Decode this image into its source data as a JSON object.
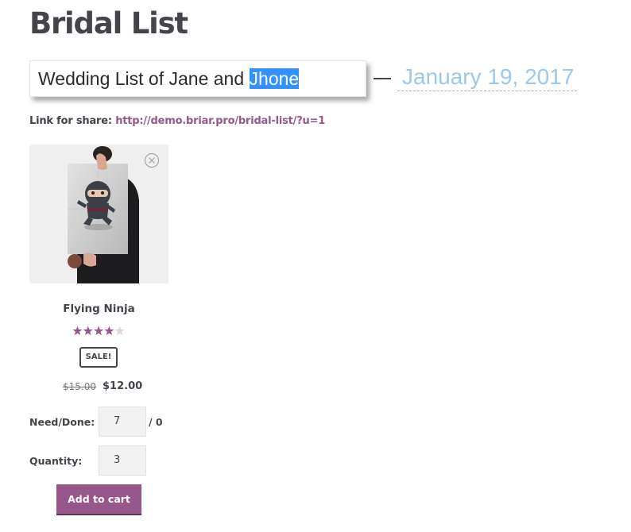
{
  "page": {
    "title": "Bridal List"
  },
  "list_title": {
    "prefix": "Wedding List of Jane and ",
    "selected": "Jhone"
  },
  "event_date": "January 19, 2017",
  "share": {
    "label": "Link for share:",
    "url": "http://demo.briar.pro/bridal-list/?u=1"
  },
  "product": {
    "name": "Flying Ninja",
    "rating": 4,
    "rating_max": 5,
    "sale_badge": "SALE!",
    "regular_price": "$15.00",
    "sale_price": "$12.00",
    "need_done_label": "Need/Done:",
    "need_value": "7",
    "done_text": "/ 0",
    "quantity_label": "Quantity:",
    "quantity_value": "3",
    "add_to_cart_label": "Add to cart"
  },
  "icons": {
    "remove": "close-circle-icon",
    "rating": "star-icon",
    "image": "ninja-poster-image"
  },
  "colors": {
    "accent": "#96588a",
    "date": "#9ec7ea",
    "selection": "#3390ff",
    "text": "#43454b",
    "star_empty": "#e3d4e0"
  }
}
